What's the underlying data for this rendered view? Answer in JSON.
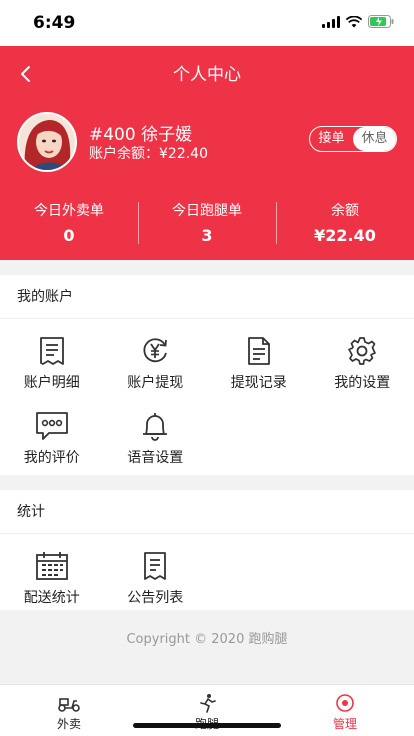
{
  "status_bar": {
    "time": "6:49"
  },
  "header": {
    "title": "个人中心",
    "user": {
      "name": "#400 徐子媛",
      "balance": "账户余额：¥22.40"
    },
    "toggle": {
      "on_label": "接单",
      "off_label": "休息"
    },
    "stats": [
      {
        "label": "今日外卖单",
        "value": "0"
      },
      {
        "label": "今日跑腿单",
        "value": "3"
      },
      {
        "label": "余额",
        "value": "¥22.40"
      }
    ]
  },
  "account": {
    "title": "我的账户",
    "items": [
      {
        "label": "账户明细",
        "icon": "document-lines-icon"
      },
      {
        "label": "账户提现",
        "icon": "yen-refresh-icon"
      },
      {
        "label": "提现记录",
        "icon": "record-doc-icon"
      },
      {
        "label": "我的设置",
        "icon": "gear-icon"
      },
      {
        "label": "我的评价",
        "icon": "comment-icon"
      },
      {
        "label": "语音设置",
        "icon": "bell-icon"
      }
    ]
  },
  "stats_section": {
    "title": "统计",
    "items": [
      {
        "label": "配送统计",
        "icon": "calendar-icon"
      },
      {
        "label": "公告列表",
        "icon": "notice-list-icon"
      }
    ]
  },
  "footer": {
    "copyright": "Copyright © 2020 跑购腿"
  },
  "tabbar": {
    "items": [
      {
        "label": "外卖",
        "icon": "scooter-icon"
      },
      {
        "label": "跑腿",
        "icon": "runner-icon"
      },
      {
        "label": "管理",
        "icon": "manage-icon"
      }
    ]
  },
  "colors": {
    "brand": "#ef3346",
    "background": "#f2f2f2",
    "text": "#222222",
    "muted": "#999999"
  }
}
